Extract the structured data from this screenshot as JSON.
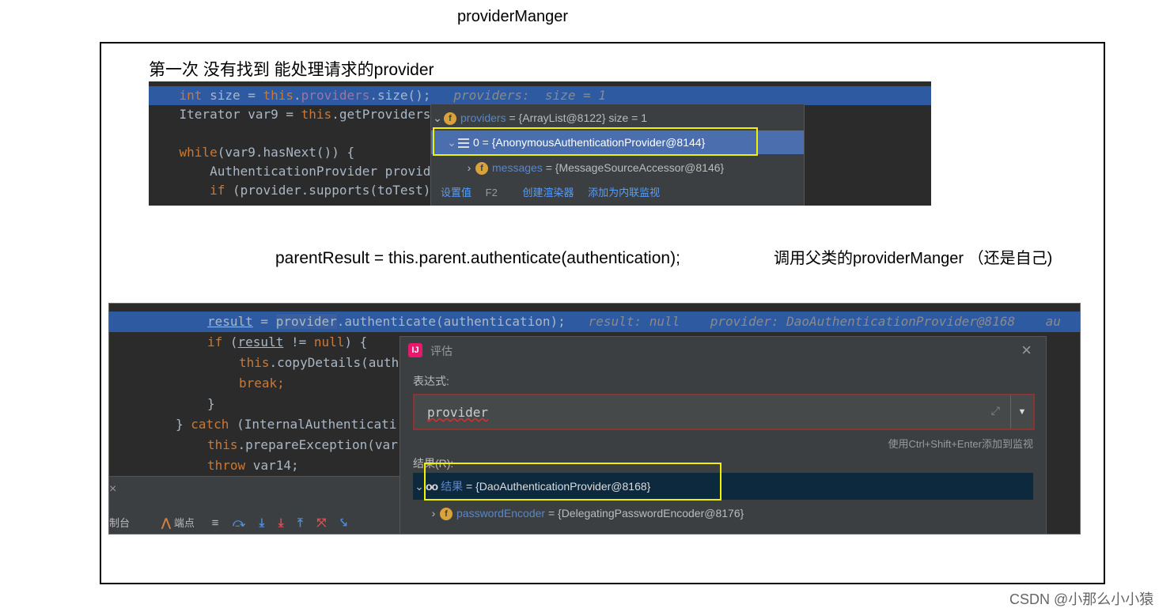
{
  "page": {
    "top_title": "providerManger",
    "caption1": "第一次 没有找到 能处理请求的provider",
    "mid_left": "parentResult = this.parent.authenticate(authentication);",
    "mid_right": "调用父类的providerManger （还是自己)",
    "watermark": "CSDN @小那么小小猿"
  },
  "screenshot1": {
    "lines": [
      {
        "a": "    ",
        "b": "int",
        "c": " size = ",
        "d": "this",
        "e": ".",
        "f": "providers",
        "g": ".size();",
        "h": "   providers:  size = 1"
      },
      {
        "t": "    Iterator var9 = ",
        "k": "this",
        "r": ".getProviders("
      },
      {
        "t": ""
      },
      {
        "k": "    while",
        "r": "(var9.hasNext()) {"
      },
      {
        "t": "        AuthenticationProvider provide"
      },
      {
        "k": "        if",
        "r": " (provider.supports(toTest))"
      }
    ],
    "popup": {
      "row1_name": "providers",
      "row1_value": " = {ArrayList@8122}  size = 1",
      "row2_text": "0 = {AnonymousAuthenticationProvider@8144}",
      "row3_name": "messages",
      "row3_value": " = {MessageSourceAccessor@8146}",
      "action1": "设置值",
      "action1_key": "F2",
      "action2": "创建渲染器",
      "action3": "添加为内联监视"
    }
  },
  "screenshot2": {
    "line1": {
      "a": "result",
      "b": " = ",
      "c": "provider",
      "d": ".authenticate(authentication);",
      "e": "   result: null    provider: DaoAuthenticationProvider@8168    au"
    },
    "line2": {
      "k": "if",
      "r": " (",
      "u": "result",
      "s": " != ",
      "n": "null",
      "z": ") {"
    },
    "line3": {
      "k": "this",
      "r": ".copyDetails(auth"
    },
    "line4": "break;",
    "line5": "}",
    "line6": {
      "a": "} ",
      "k": "catch",
      "r": " (InternalAuthenticati"
    },
    "line7": {
      "k": "this",
      "r": ".prepareException(var"
    },
    "line8": {
      "k": "throw",
      "r": " var14;"
    },
    "dialog": {
      "title": "评估",
      "expr_label": "表达式:",
      "expr_value": "provider",
      "hint": "使用Ctrl+Shift+Enter添加到监视",
      "result_label": "结果(R):",
      "result_name": "结果",
      "result_value": " = {DaoAuthenticationProvider@8168}",
      "child_name": "passwordEncoder",
      "child_value": " = {DelegatingPasswordEncoder@8176}"
    },
    "toolbar": {
      "console_label": "制台",
      "breakpoints_label": "端点"
    }
  }
}
